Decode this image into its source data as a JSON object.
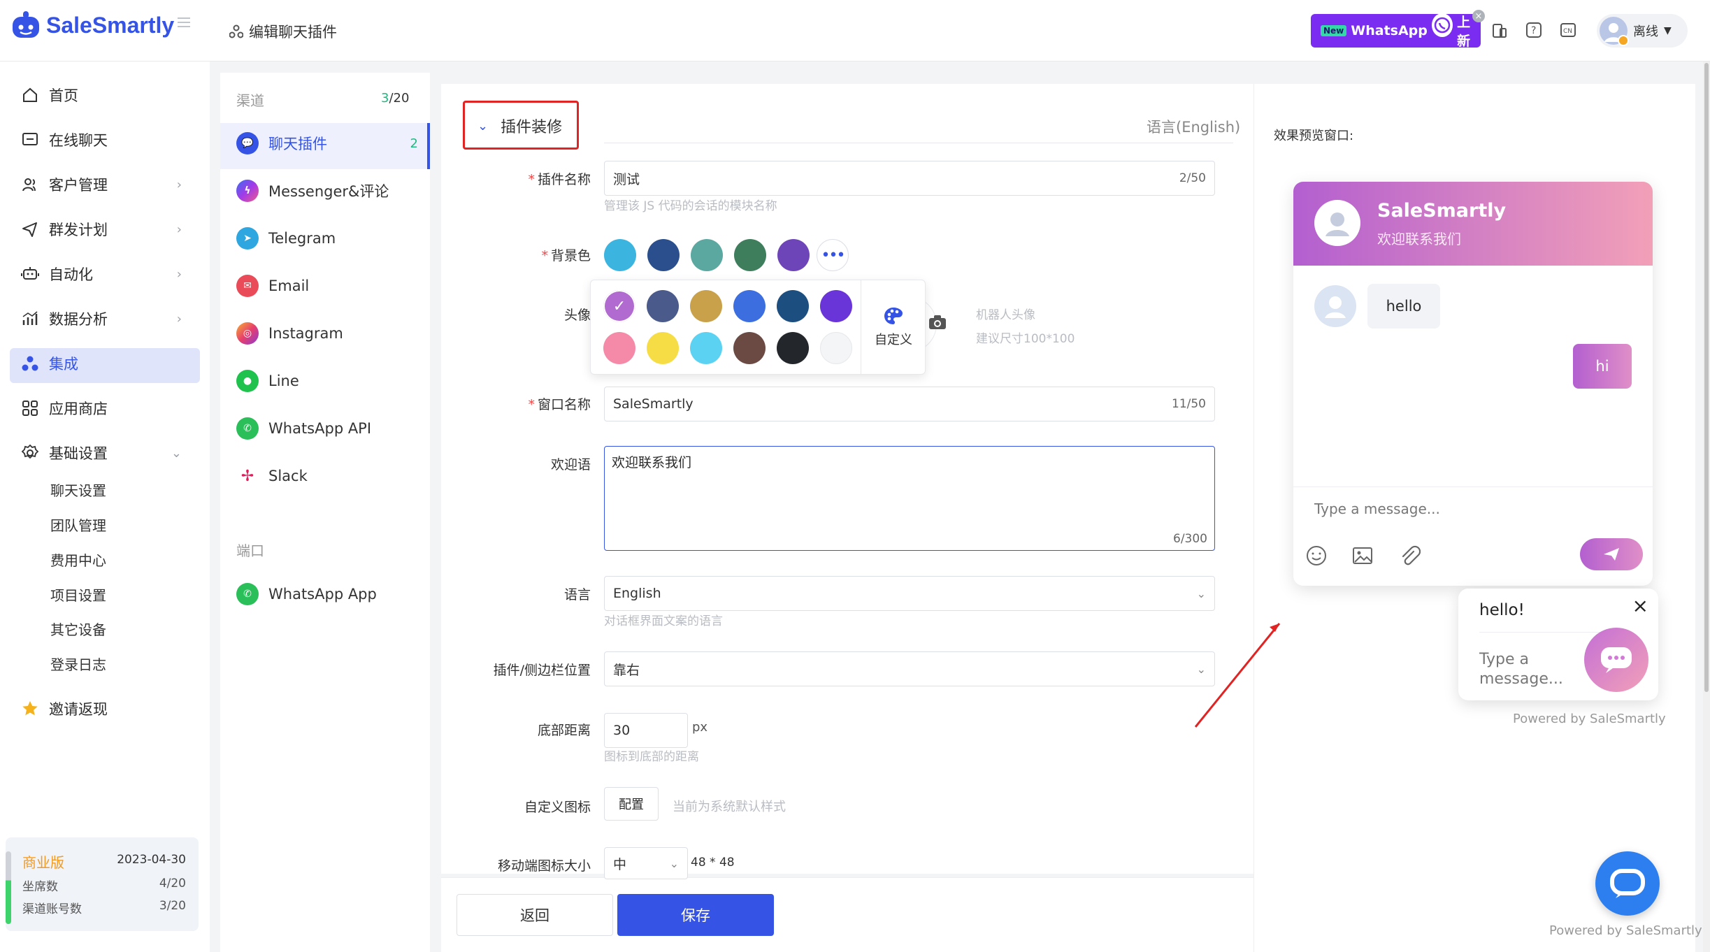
{
  "brand": {
    "name": "SaleSmartly",
    "accent": "#3554e6"
  },
  "header": {
    "breadcrumb": "编辑聊天插件",
    "promo_new": "New",
    "promo_app": "WhatsApp",
    "promo_suffix": "上新",
    "user_status": "离线"
  },
  "sidebar": {
    "items": [
      {
        "label": "首页",
        "icon": "home-icon"
      },
      {
        "label": "在线聊天",
        "icon": "chat-icon"
      },
      {
        "label": "客户管理",
        "icon": "users-icon"
      },
      {
        "label": "群发计划",
        "icon": "send-icon"
      },
      {
        "label": "自动化",
        "icon": "robot-icon"
      },
      {
        "label": "数据分析",
        "icon": "chart-icon"
      },
      {
        "label": "集成",
        "icon": "integration-icon"
      },
      {
        "label": "应用商店",
        "icon": "apps-icon"
      },
      {
        "label": "基础设置",
        "icon": "gear-icon"
      }
    ],
    "sub_items": [
      "聊天设置",
      "团队管理",
      "费用中心",
      "项目设置",
      "其它设备",
      "登录日志"
    ],
    "invite": "邀请返现",
    "plan": {
      "name": "商业版",
      "date": "2023-04-30",
      "seats_label": "坐席数",
      "seats": "4/20",
      "channels_label": "渠道账号数",
      "channels": "3/20"
    }
  },
  "channels": {
    "title": "渠道",
    "count": "3",
    "total": "/20",
    "items": [
      {
        "label": "聊天插件",
        "badge": "2"
      },
      {
        "label": "Messenger&评论"
      },
      {
        "label": "Telegram"
      },
      {
        "label": "Email"
      },
      {
        "label": "Instagram"
      },
      {
        "label": "Line"
      },
      {
        "label": "WhatsApp API"
      },
      {
        "label": "Slack"
      }
    ],
    "port_title": "端口",
    "port_items": [
      {
        "label": "WhatsApp App"
      }
    ]
  },
  "form": {
    "section_title": "插件装修",
    "language_note": "语言(English)",
    "name_label": "插件名称",
    "name_value": "测试",
    "name_count": "2/50",
    "name_hint": "管理该 JS 代码的会话的模块名称",
    "bg_label": "背景色",
    "avatar_label": "头像",
    "avatar_hint1": "机器人头像",
    "avatar_hint2": "建议尺寸100*100",
    "custom_label": "自定义",
    "window_label": "窗口名称",
    "window_value": "SaleSmartly",
    "window_count": "11/50",
    "welcome_label": "欢迎语",
    "welcome_value": "欢迎联系我们",
    "welcome_count": "6/300",
    "lang_label": "语言",
    "lang_value": "English",
    "lang_hint": "对话框界面文案的语言",
    "pos_label": "插件/侧边栏位置",
    "pos_value": "靠右",
    "bottom_label": "底部距离",
    "bottom_value": "30",
    "bottom_unit": "px",
    "bottom_hint": "图标到底部的距离",
    "icon_label": "自定义图标",
    "icon_btn": "配置",
    "icon_hint": "当前为系统默认样式",
    "mobile_label": "移动端图标大小",
    "mobile_value": "中",
    "mobile_size": "48 * 48"
  },
  "footer": {
    "back": "返回",
    "save": "保存"
  },
  "preview": {
    "title": "效果预览窗口:",
    "header_name": "SaleSmartly",
    "header_sub": "欢迎联系我们",
    "msg_in": "hello",
    "msg_out": "hi",
    "input_placeholder": "Type a message...",
    "popup_title": "hello!",
    "popup_placeholder": "Type a message...",
    "powered": "Powered by SaleSmartly",
    "powered2": "Powered by SaleSmartly"
  },
  "colors": {
    "bg_swatches": [
      "#3bb4e0",
      "#2a4f8c",
      "#5aa8a0",
      "#3f7e5c",
      "#6e45b8"
    ],
    "avatar_swatches": [
      "#b06ad0",
      "#4a5a8a",
      "#c9a14a",
      "#3c6ee0",
      "#1d4e80",
      "#6a35d8",
      "#f58aa8",
      "#f6dd45",
      "#5cd2f2",
      "#6b4a44",
      "#23262b",
      "#f4f5f7"
    ]
  }
}
